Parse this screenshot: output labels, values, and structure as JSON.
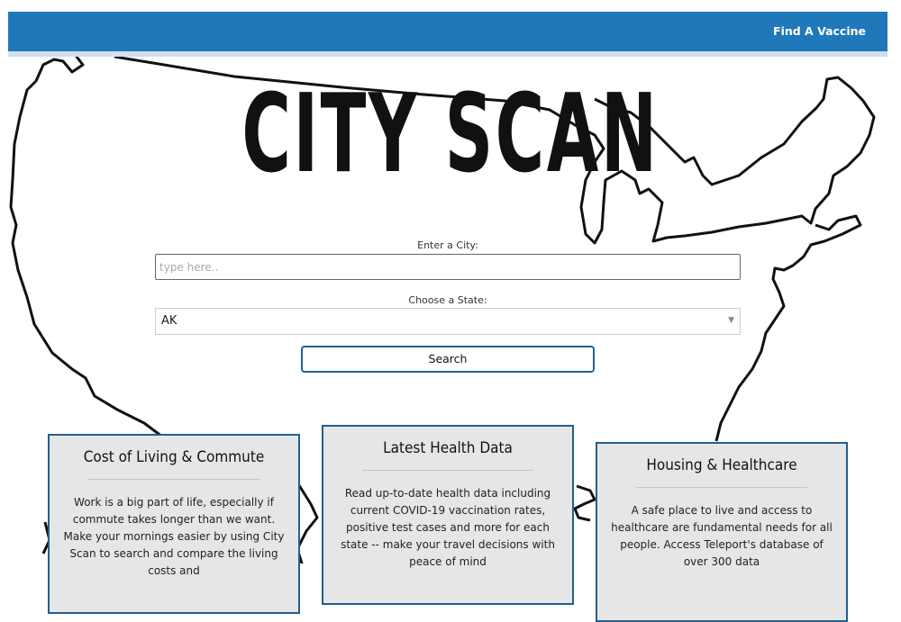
{
  "navbar": {
    "link_label": "Find A Vaccine"
  },
  "hero": {
    "title": "CITY SCAN"
  },
  "form": {
    "city_label": "Enter a City:",
    "city_placeholder": "type here..",
    "city_value": "",
    "state_label": "Choose a State:",
    "state_selected": "AK",
    "search_label": "Search"
  },
  "cards": [
    {
      "title": "Cost of Living & Commute",
      "body": "Work is a big part of life, especially if commute takes longer than we want. Make your mornings easier by using City Scan to search and compare the living costs and"
    },
    {
      "title": "Latest Health Data",
      "body": "Read up-to-date health data including current COVID-19 vaccination rates, positive test cases and more for each state -- make your travel decisions with peace of mind"
    },
    {
      "title": "Housing & Healthcare",
      "body": "A safe place to live and access to healthcare are fundamental needs for all people. Access Teleport's database of over 300 data"
    }
  ],
  "colors": {
    "navbar": "#1f78b9",
    "card_border": "#245f8d",
    "card_bg": "#e6e6e6"
  }
}
